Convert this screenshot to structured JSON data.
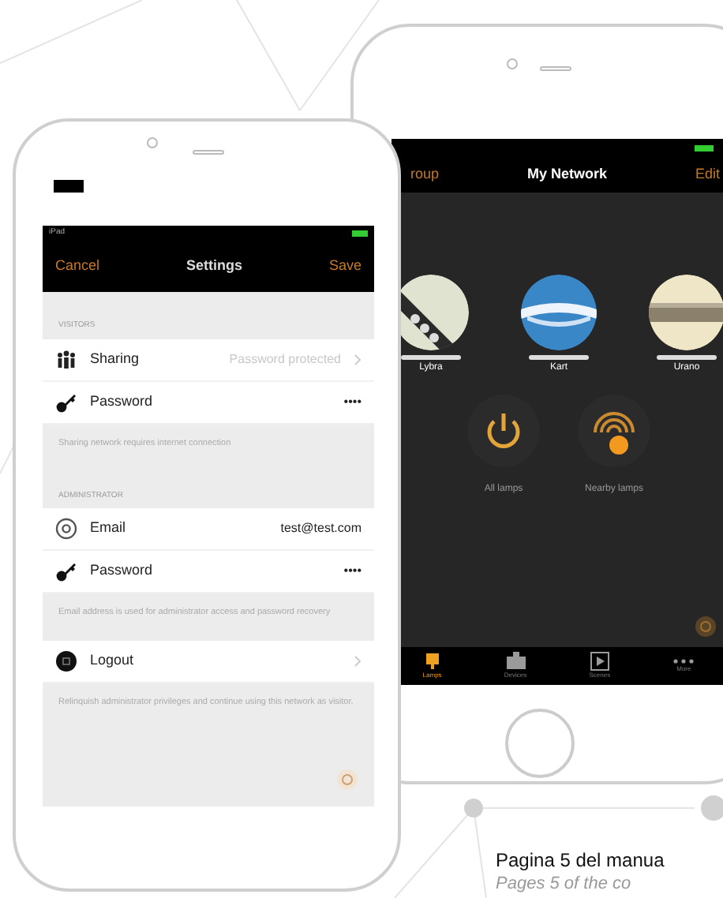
{
  "settings_screen": {
    "status_bar": {
      "carrier": "iPad"
    },
    "nav": {
      "left": "Cancel",
      "title": "Settings",
      "right": "Save"
    },
    "sections": [
      {
        "header": "VISITORS",
        "rows": [
          {
            "kind": "people",
            "label": "Sharing",
            "value": "Password protected",
            "chevron": true
          },
          {
            "kind": "key",
            "label": "Password",
            "value": "••••",
            "chevron": false
          }
        ],
        "footer": "Sharing network requires internet connection"
      },
      {
        "header": "ADMINISTRATOR",
        "rows": [
          {
            "kind": "at",
            "label": "Email",
            "value": "test@test.com",
            "chevron": false
          },
          {
            "kind": "key",
            "label": "Password",
            "value": "••••",
            "chevron": false
          }
        ],
        "footer": "Email address is used for administrator access and password recovery"
      },
      {
        "rows": [
          {
            "kind": "logout",
            "label": "Logout",
            "chevron": true
          }
        ],
        "footer": "Relinquish administrator privileges and continue using this network as visitor."
      }
    ]
  },
  "network_screen": {
    "nav": {
      "left": "roup",
      "title": "My Network",
      "right": "Edit"
    },
    "lamps": [
      {
        "name": "Lybra",
        "kind": "picture"
      },
      {
        "name": "Kart",
        "kind": "picture"
      },
      {
        "name": "Urano",
        "kind": "picture"
      }
    ],
    "actions": [
      {
        "kind": "power",
        "label": "All lamps"
      },
      {
        "kind": "nearby",
        "label": "Nearby lamps"
      }
    ],
    "tabs": [
      {
        "kind": "lamp",
        "label": "Lamps",
        "selected": true
      },
      {
        "kind": "device",
        "label": "Devices",
        "selected": false
      },
      {
        "kind": "scene",
        "label": "Scenes",
        "selected": false
      },
      {
        "kind": "more",
        "label": "More",
        "selected": false
      }
    ]
  },
  "caption": {
    "title": "Pagina 5 del manua",
    "subtitle": "Pages 5 of the co"
  }
}
